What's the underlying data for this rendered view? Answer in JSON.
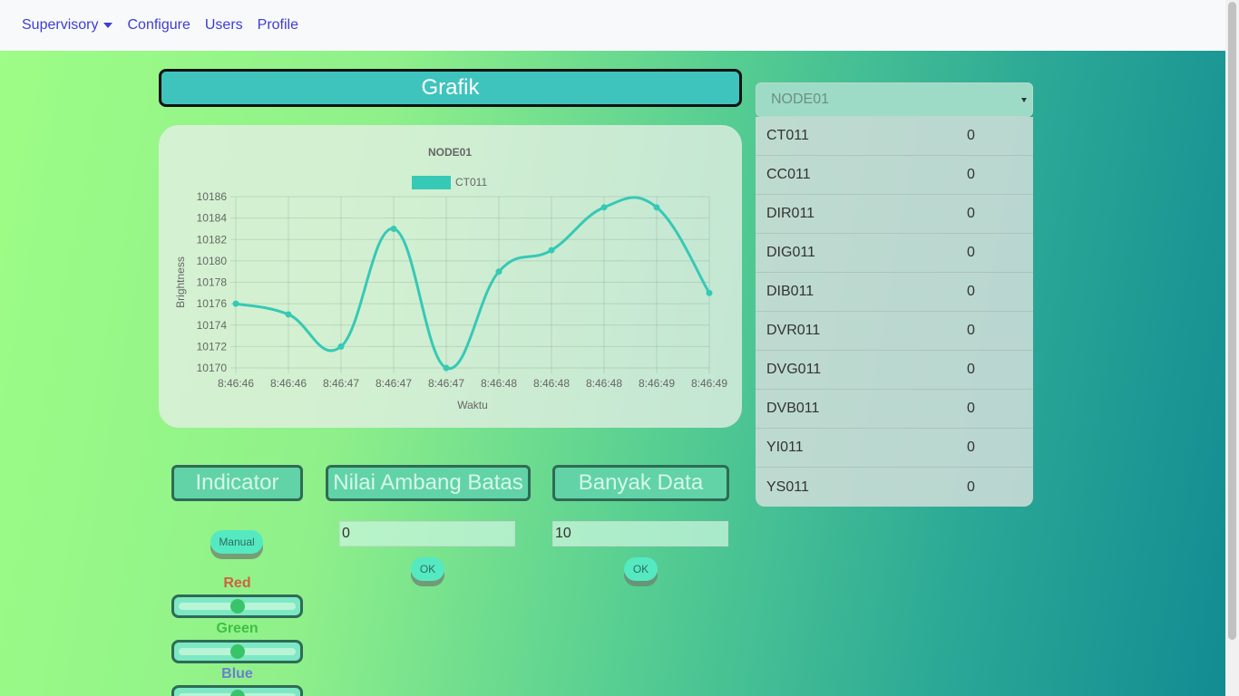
{
  "nav": {
    "items": [
      {
        "label": "Supervisory"
      },
      {
        "label": "Configure"
      },
      {
        "label": "Users"
      },
      {
        "label": "Profile"
      }
    ]
  },
  "chart_section": {
    "title": "Grafik"
  },
  "chart_data": {
    "type": "line",
    "title": "NODE01",
    "xlabel": "Waktu",
    "ylabel": "Brightness",
    "x": [
      "8:46:46",
      "8:46:46",
      "8:46:47",
      "8:46:47",
      "8:46:47",
      "8:46:48",
      "8:46:48",
      "8:46:48",
      "8:46:49",
      "8:46:49"
    ],
    "yticks": [
      10170,
      10172,
      10174,
      10176,
      10178,
      10180,
      10182,
      10184,
      10186
    ],
    "ylim": [
      10170,
      10186
    ],
    "series": [
      {
        "name": "CT011",
        "values": [
          10176,
          10175,
          10172,
          10183,
          10170,
          10179,
          10181,
          10185,
          10185,
          10177
        ],
        "color": "#36c9b5"
      }
    ],
    "grid": true,
    "legend": "top"
  },
  "node_select": {
    "value": "NODE01"
  },
  "sensors": [
    {
      "name": "CT011",
      "value": "0"
    },
    {
      "name": "CC011",
      "value": "0"
    },
    {
      "name": "DIR011",
      "value": "0"
    },
    {
      "name": "DIG011",
      "value": "0"
    },
    {
      "name": "DIB011",
      "value": "0"
    },
    {
      "name": "DVR011",
      "value": "0"
    },
    {
      "name": "DVG011",
      "value": "0"
    },
    {
      "name": "DVB011",
      "value": "0"
    },
    {
      "name": "YI011",
      "value": "0"
    },
    {
      "name": "YS011",
      "value": "0"
    }
  ],
  "indicator": {
    "title": "Indicator",
    "mode_button": "Manual",
    "red_label": "Red",
    "green_label": "Green",
    "blue_label": "Blue",
    "red_level": 0.5,
    "green_level": 0.5,
    "blue_level": 0.5,
    "colors": {
      "red": "#d0623f",
      "green": "#3fbf45",
      "blue": "#6b7fd0"
    }
  },
  "threshold": {
    "title": "Nilai Ambang Batas",
    "value": "0",
    "ok_label": "OK"
  },
  "data_count": {
    "title": "Banyak Data",
    "value": "10",
    "ok_label": "OK"
  }
}
